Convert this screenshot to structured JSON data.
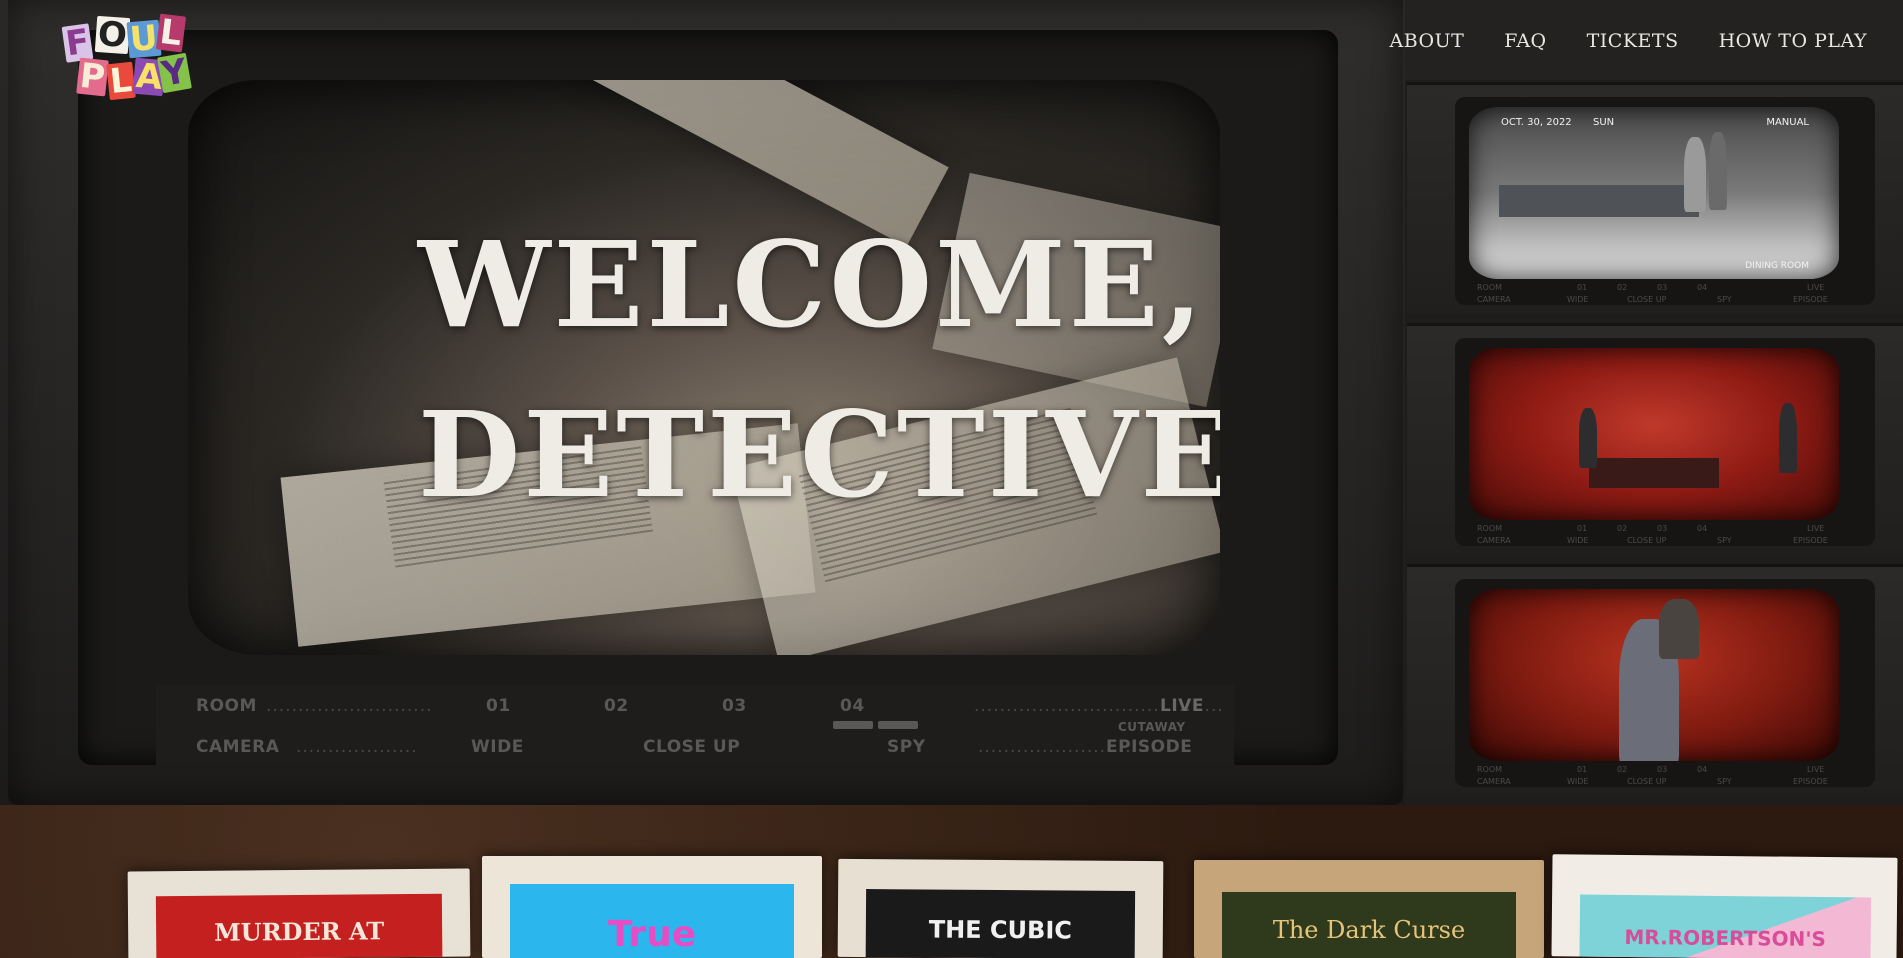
{
  "logo": {
    "letters": [
      "F",
      "O",
      "U",
      "L",
      "P",
      "L",
      "A",
      "Y"
    ],
    "alt": "FOUL PLAY"
  },
  "nav": {
    "items": [
      "ABOUT",
      "FAQ",
      "TICKETS",
      "HOW TO PLAY"
    ]
  },
  "hero": {
    "headline_line1": "WELCOME,",
    "headline_line2": "DETECTIVE"
  },
  "control_strip": {
    "room_label": "ROOM",
    "rooms": [
      "01",
      "02",
      "03",
      "04"
    ],
    "live_label": "LIVE",
    "cutaway_label": "CUTAWAY",
    "camera_label": "CAMERA",
    "camera_modes": [
      "WIDE",
      "CLOSE UP",
      "SPY"
    ],
    "episode_label": "EPISODE"
  },
  "side_monitors": [
    {
      "date": "OCT. 30, 2022",
      "day": "SUN",
      "mode": "MANUAL",
      "room": "DINING ROOM",
      "style": "grayscale"
    },
    {
      "style": "red"
    },
    {
      "style": "red"
    }
  ],
  "cards": [
    {
      "title": "MURDER AT",
      "bg": "#c4201f",
      "fg": "#f4e6d8",
      "paper": "#e8e2d6"
    },
    {
      "title": "True",
      "bg": "#2bb6ee",
      "fg": "#e84cc4",
      "paper": "#ede5d8"
    },
    {
      "title": "THE CUBIC",
      "bg": "#1a1a1a",
      "fg": "#f0f0f0",
      "paper": "#e6dfd2"
    },
    {
      "title": "The Dark Curse",
      "bg": "#2f3a1c",
      "fg": "#e6c37a",
      "paper": "#c7a57a"
    },
    {
      "title": "MR.ROBERTSON'S",
      "bg": "#7ed3d8",
      "fg": "#d94c9a",
      "paper": "#f1ede6"
    }
  ],
  "colors": {
    "nav_text": "#e9e6e0",
    "headline": "#efece6"
  }
}
